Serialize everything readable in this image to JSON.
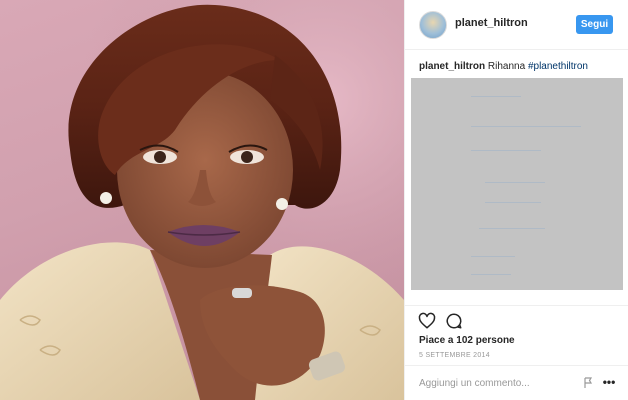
{
  "post": {
    "username": "planet_hiltron",
    "follow_label": "Segui",
    "caption": {
      "username": "planet_hiltron",
      "text": "Rihanna",
      "hashtag": "#planethiltron"
    },
    "likes_text": "Piace a 102 persone",
    "date_text": "5 SETTEMBRE 2014",
    "comment_placeholder": "Aggiungi un commento..."
  },
  "photo": {
    "subject": "painted portrait of a woman with a short auburn bob, purple lipstick, pearl earrings and a cream jacket"
  },
  "icons": {
    "avatar": "avatar-image",
    "like": "heart-icon",
    "comment": "comment-bubble-icon",
    "flag": "flag-icon",
    "more": "more-options-icon"
  },
  "colors": {
    "follow_button": "#3897f0",
    "hashtag": "#003569",
    "redacted_block": "#c3c3c3",
    "background_pink": "#d4a3b1"
  }
}
